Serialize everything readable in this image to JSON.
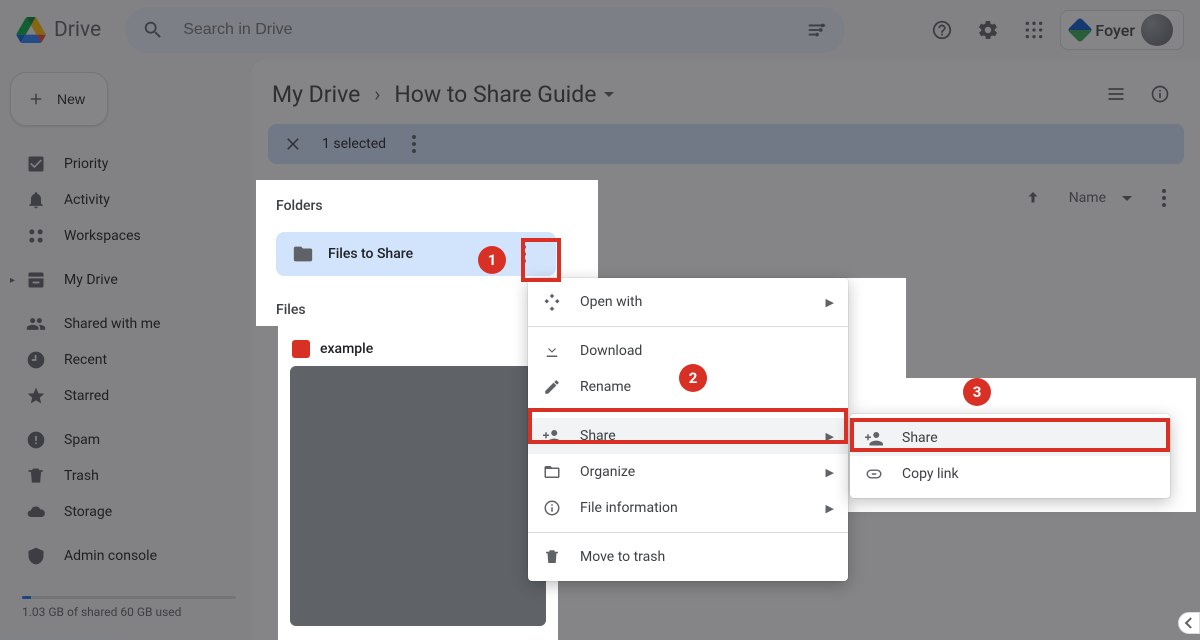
{
  "brand": {
    "name": "Drive"
  },
  "search": {
    "placeholder": "Search in Drive"
  },
  "headerRight": {
    "foyer": "Foyer"
  },
  "sidebar": {
    "new": "New",
    "items": [
      {
        "label": "Priority"
      },
      {
        "label": "Activity"
      },
      {
        "label": "Workspaces"
      },
      {
        "label": "My Drive"
      },
      {
        "label": "Shared with me"
      },
      {
        "label": "Recent"
      },
      {
        "label": "Starred"
      },
      {
        "label": "Spam"
      },
      {
        "label": "Trash"
      },
      {
        "label": "Storage"
      },
      {
        "label": "Admin console"
      }
    ],
    "storage": "1.03 GB of shared 60 GB used"
  },
  "crumbs": {
    "root": "My Drive",
    "leaf": "How to Share Guide"
  },
  "selection": {
    "text": "1 selected"
  },
  "listbar": {
    "sort": "Name"
  },
  "sections": {
    "folders": "Folders",
    "files": "Files"
  },
  "folder": {
    "label": "Files to Share"
  },
  "file": {
    "label": "example"
  },
  "menu": {
    "open": "Open with",
    "download": "Download",
    "rename": "Rename",
    "share": "Share",
    "organize": "Organize",
    "info": "File information",
    "trash": "Move to trash"
  },
  "submenu": {
    "share": "Share",
    "copy": "Copy link"
  },
  "annot": {
    "n1": "1",
    "n2": "2",
    "n3": "3"
  }
}
